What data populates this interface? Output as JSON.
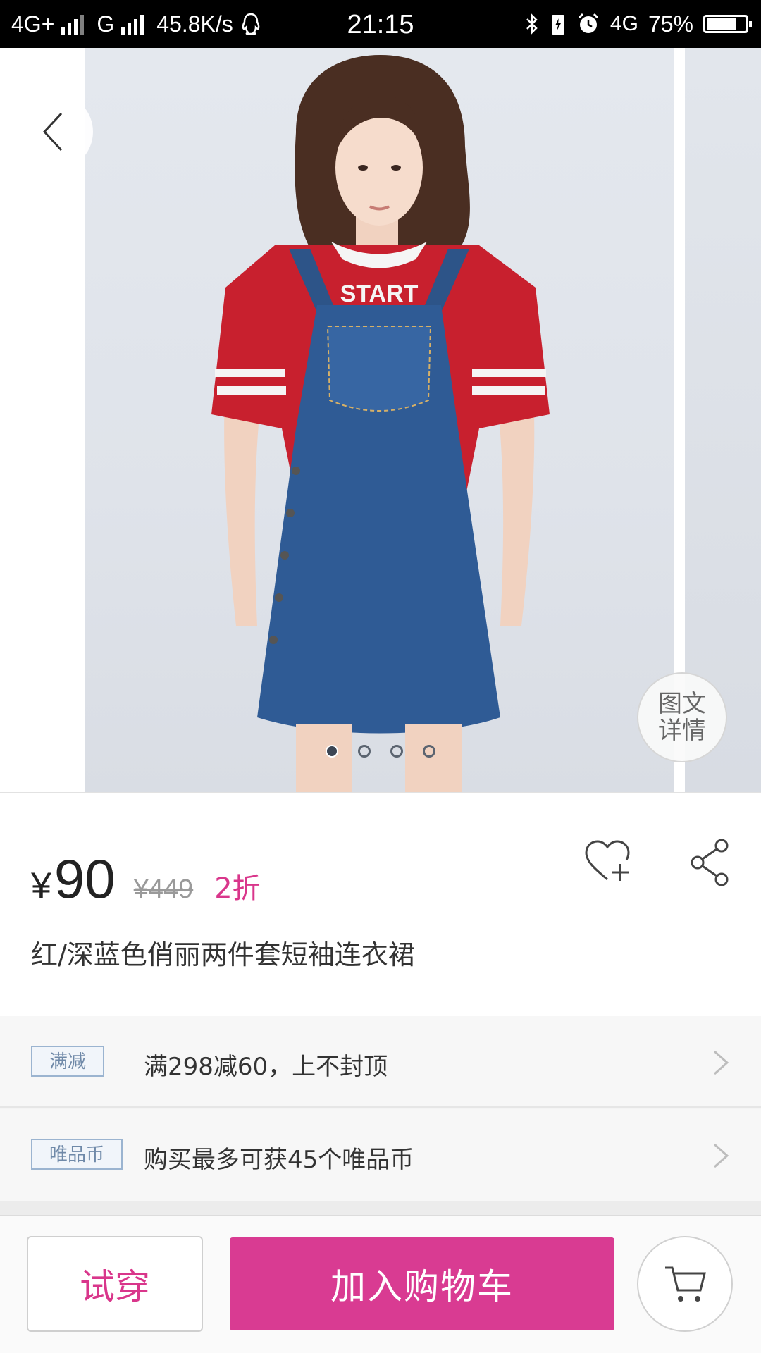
{
  "status_bar": {
    "network1": "4G+",
    "network2": "G",
    "speed": "45.8K/s",
    "time": "21:15",
    "network3": "4G",
    "battery": "75%",
    "battery_level": 0.75,
    "icons": [
      "qq-icon",
      "bluetooth-icon",
      "charging-icon",
      "alarm-icon"
    ]
  },
  "gallery": {
    "detail_button": [
      "图文",
      "详情"
    ],
    "page_count": 4,
    "active_page": 1
  },
  "product": {
    "currency": "¥",
    "price": "90",
    "original_price": "¥449",
    "discount": "2折",
    "title": "红/深蓝色俏丽两件套短袖连衣裙",
    "shirt_print": "START"
  },
  "promos": [
    {
      "tag": "满减",
      "text": "满298减60，上不封顶"
    },
    {
      "tag": "唯品币",
      "text": "购买最多可获45个唯品币"
    }
  ],
  "bottom_bar": {
    "try_on": "试穿",
    "add_to_cart": "加入购物车"
  },
  "colors": {
    "accent": "#d93b92",
    "tag_border": "#9bb4d0",
    "tag_text": "#6f89a8"
  }
}
